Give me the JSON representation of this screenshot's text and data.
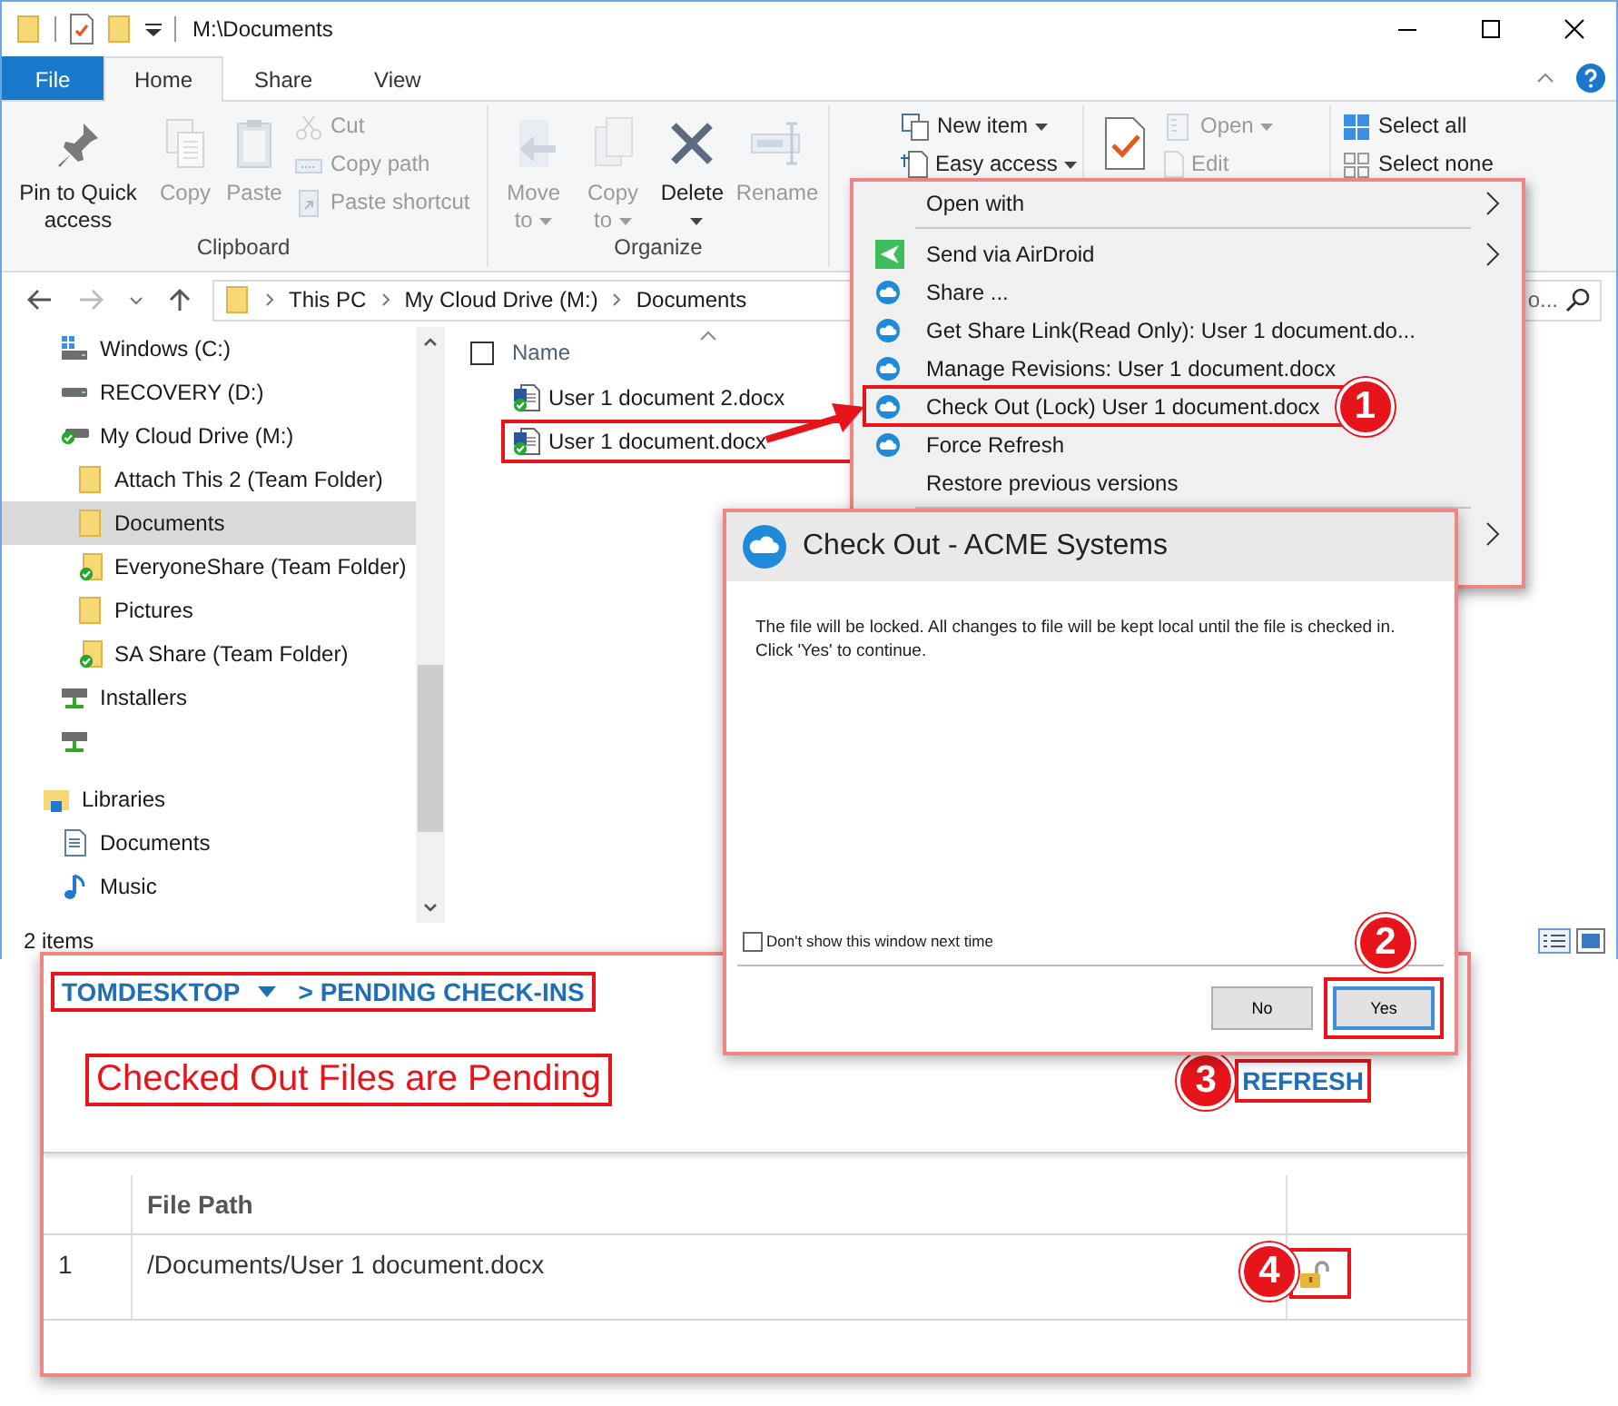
{
  "window": {
    "title": "M:\\Documents"
  },
  "ribbon_tabs": [
    {
      "label": "File",
      "kind": "file",
      "selected": false
    },
    {
      "label": "Home",
      "kind": "tab",
      "selected": true
    },
    {
      "label": "Share",
      "kind": "tab",
      "selected": false
    },
    {
      "label": "View",
      "kind": "tab",
      "selected": false
    }
  ],
  "ribbon_groups": [
    {
      "label": "Clipboard",
      "columns": [
        [
          {
            "label": "Pin to Quick access",
            "kind": "large",
            "disabled": false,
            "dropdown": false
          }
        ],
        [
          {
            "label": "Copy",
            "kind": "large",
            "disabled": true,
            "dropdown": false
          }
        ],
        [
          {
            "label": "Paste",
            "kind": "large",
            "disabled": true,
            "dropdown": false
          }
        ],
        [
          {
            "label": "Cut",
            "kind": "small",
            "disabled": true,
            "dropdown": false
          },
          {
            "label": "Copy path",
            "kind": "small",
            "disabled": true,
            "dropdown": false
          },
          {
            "label": "Paste shortcut",
            "kind": "small",
            "disabled": true,
            "dropdown": false
          }
        ]
      ]
    },
    {
      "label": "Organize",
      "columns": [
        [
          {
            "label": "Move to",
            "kind": "large",
            "disabled": true,
            "dropdown": true
          }
        ],
        [
          {
            "label": "Copy to",
            "kind": "large",
            "disabled": true,
            "dropdown": true
          }
        ],
        [
          {
            "label": "Delete",
            "kind": "large",
            "disabled": false,
            "dropdown": true
          }
        ],
        [
          {
            "label": "Rename",
            "kind": "large",
            "disabled": true,
            "dropdown": false
          }
        ]
      ]
    },
    {
      "columns": [
        [
          {
            "label": "New item",
            "kind": "small",
            "disabled": false,
            "dropdown": true
          },
          {
            "label": "Easy access",
            "kind": "small",
            "disabled": false,
            "dropdown": true
          }
        ]
      ]
    },
    {
      "columns": [
        [
          {
            "kind": "large",
            "disabled": false,
            "dropdown": false
          }
        ],
        [
          {
            "label": "Open",
            "kind": "small",
            "disabled": true,
            "dropdown": true
          },
          {
            "label": "Edit",
            "kind": "small",
            "disabled": true,
            "dropdown": false
          }
        ]
      ]
    },
    {
      "columns": [
        [
          {
            "label": "Select all",
            "kind": "small",
            "disabled": false,
            "dropdown": false
          },
          {
            "label": "Select none",
            "kind": "small",
            "disabled": false,
            "dropdown": false
          }
        ]
      ]
    }
  ],
  "address": {
    "path": [
      "This PC",
      "My Cloud Drive (M:)",
      "Documents"
    ],
    "search_text": "o..."
  },
  "navigation": [
    {
      "label": "Windows (C:)",
      "kind": "system-drive",
      "selected": false
    },
    {
      "label": "RECOVERY (D:)",
      "kind": "drive",
      "selected": false
    },
    {
      "label": "My Cloud Drive (M:)",
      "kind": "cloud-drive",
      "selected": false,
      "children": [
        {
          "label": "Attach This 2 (Team Folder)",
          "kind": "folder",
          "selected": false
        },
        {
          "label": "Documents",
          "kind": "folder",
          "selected": true
        },
        {
          "label": "EveryoneShare (Team Folder)",
          "kind": "synced-folder",
          "selected": false
        },
        {
          "label": "Pictures",
          "kind": "folder",
          "selected": false
        },
        {
          "label": "SA Share (Team Folder)",
          "kind": "synced-folder",
          "selected": false
        }
      ]
    },
    {
      "label": "Installers",
      "kind": "network-drive",
      "selected": false
    },
    {
      "kind": "network-drive",
      "selected": false
    },
    {
      "label": "Libraries",
      "kind": "library",
      "selected": false,
      "children": [
        {
          "label": "Documents",
          "kind": "documents-library",
          "selected": false
        },
        {
          "label": "Music",
          "kind": "music-library",
          "selected": false
        }
      ]
    }
  ],
  "files": {
    "column": "Name",
    "select_all_checked": false,
    "items": [
      {
        "name": "User 1 document 2.docx",
        "selected": false,
        "highlighted": false
      },
      {
        "name": "User 1 document.docx",
        "selected": true,
        "highlighted": true
      }
    ]
  },
  "status_bar": {
    "count": "2 items"
  },
  "context_menu": [
    {
      "kind": "plain",
      "label": "Open with",
      "submenu": true,
      "highlighted": false
    },
    {
      "kind": "separator"
    },
    {
      "kind": "airdroid",
      "label": "Send via AirDroid",
      "submenu": true,
      "highlighted": false
    },
    {
      "kind": "cloud",
      "label": "Share ...",
      "submenu": false,
      "highlighted": false
    },
    {
      "kind": "cloud",
      "label": "Get Share Link(Read Only): User 1 document.do...",
      "submenu": false,
      "highlighted": false
    },
    {
      "kind": "cloud",
      "label": "Manage Revisions: User 1 document.docx",
      "submenu": false,
      "highlighted": false
    },
    {
      "kind": "cloud",
      "label": "Check Out (Lock) User 1 document.docx",
      "submenu": false,
      "highlighted": true,
      "callout": "1"
    },
    {
      "kind": "cloud",
      "label": "Force Refresh",
      "submenu": false,
      "highlighted": false
    },
    {
      "kind": "plain",
      "label": "Restore previous versions",
      "submenu": false,
      "highlighted": false
    },
    {
      "kind": "separator"
    },
    {
      "kind": "plain",
      "submenu": true,
      "highlighted": false
    }
  ],
  "dialog": {
    "title": "Check Out - ACME Systems",
    "message": "The file will be locked. All changes to file will be kept local until the file is checked in. Click 'Yes' to continue.",
    "checkbox": {
      "label": "Don't show this window next time",
      "checked": false
    },
    "buttons": [
      {
        "label": "No",
        "default": false,
        "highlighted": false
      },
      {
        "label": "Yes",
        "default": true,
        "highlighted": true,
        "callout": "2"
      }
    ]
  },
  "panel": {
    "breadcrumb_highlighted": true,
    "breadcrumb": [
      {
        "label": "TOMDESKTOP",
        "dropdown": true
      },
      {
        "label": "> PENDING CHECK-INS",
        "dropdown": false
      }
    ],
    "heading": {
      "text": "Checked Out Files are Pending",
      "highlighted": true
    },
    "refresh": {
      "label": "REFRESH",
      "highlighted": true,
      "callout": "3"
    },
    "table": {
      "columns": [
        {
          "kind": "index"
        },
        {
          "kind": "text",
          "label": "File Path"
        },
        {
          "kind": "action"
        }
      ],
      "rows": [
        {
          "index": "1",
          "path": "/Documents/User 1 document.docx",
          "locked": false,
          "lock_highlighted": true,
          "callout": "4"
        }
      ]
    }
  }
}
